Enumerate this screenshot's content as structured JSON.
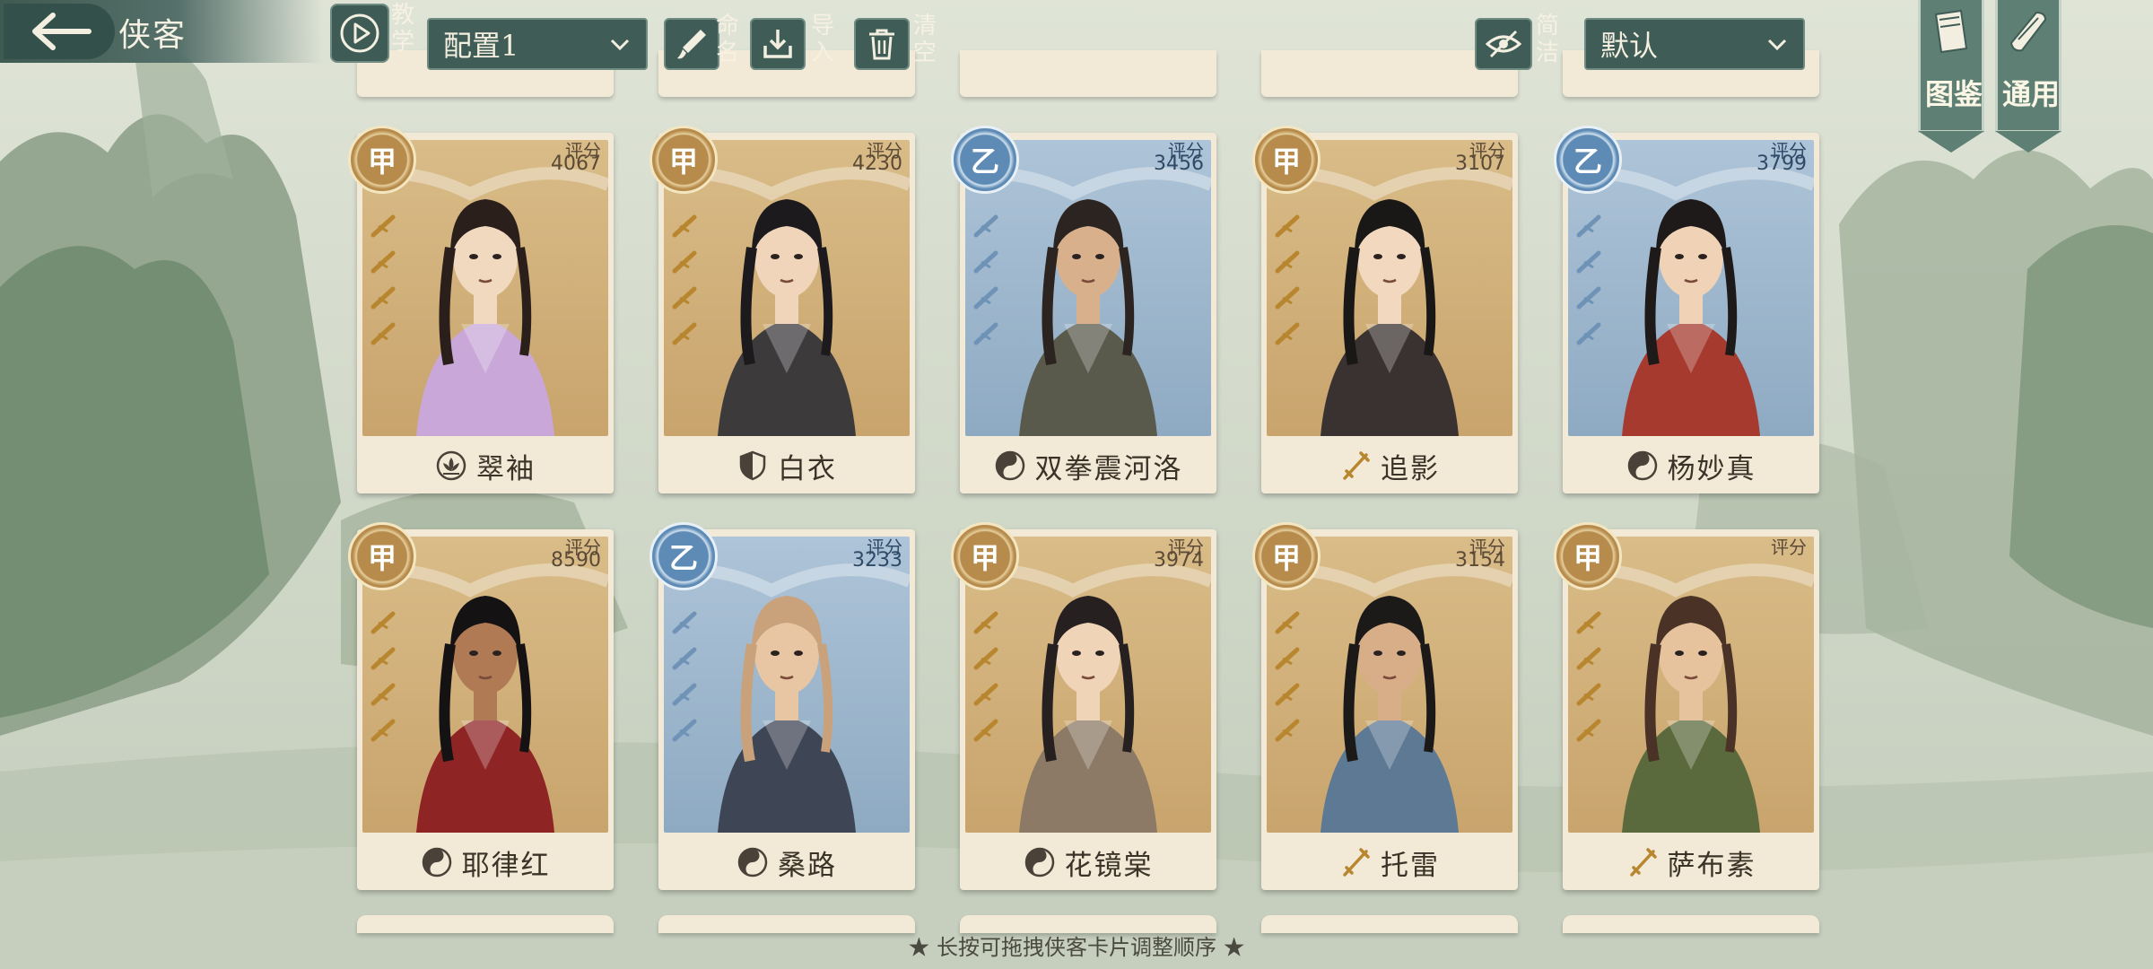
{
  "header": {
    "title": "侠客",
    "tutorial_label": "教学",
    "config_select": "配置1",
    "rename_label": "命名",
    "import_label": "导入",
    "clear_label": "清空",
    "simple_label": "简洁",
    "sort_select": "默认",
    "codex_label": "图鉴",
    "general_label": "通用"
  },
  "score_label": "评分",
  "cards": [
    {
      "name": "翠袖",
      "grade": "甲",
      "score": "4067",
      "faction_icon": "lotus-icon"
    },
    {
      "name": "白衣",
      "grade": "甲",
      "score": "4230",
      "faction_icon": "shield-icon"
    },
    {
      "name": "双拳震河洛",
      "grade": "乙",
      "score": "3456",
      "faction_icon": "taiji-icon"
    },
    {
      "name": "追影",
      "grade": "甲",
      "score": "3107",
      "faction_icon": "sword-icon"
    },
    {
      "name": "杨妙真",
      "grade": "乙",
      "score": "3799",
      "faction_icon": "taiji-icon"
    },
    {
      "name": "耶律红",
      "grade": "甲",
      "score": "8590",
      "faction_icon": "taiji-icon"
    },
    {
      "name": "桑路",
      "grade": "乙",
      "score": "3233",
      "faction_icon": "taiji-icon"
    },
    {
      "name": "花镜棠",
      "grade": "甲",
      "score": "3974",
      "faction_icon": "taiji-icon"
    },
    {
      "name": "托雷",
      "grade": "甲",
      "score": "3154",
      "faction_icon": "sword-icon"
    },
    {
      "name": "萨布素",
      "grade": "甲",
      "score": "",
      "faction_icon": "sword-icon"
    }
  ],
  "footer_hint": "★ 长按可拖拽侠客卡片调整顺序 ★",
  "colors": {
    "jia": "#b78b4b",
    "yi": "#5e8bb5",
    "bar": "#3f5c56"
  }
}
